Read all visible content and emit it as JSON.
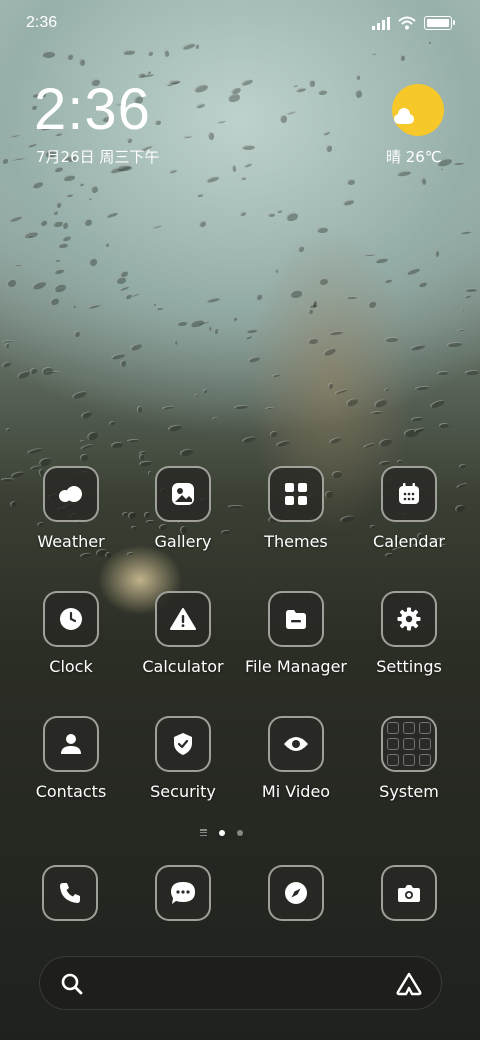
{
  "status_bar": {
    "time": "2:36"
  },
  "lockclock": {
    "time": "2:36",
    "date": "7月26日 周三下午"
  },
  "weather": {
    "text": "晴 26℃",
    "icon": "sun-cloud-icon",
    "sun_color": "#f6c82a"
  },
  "apps": [
    {
      "label": "Weather",
      "icon": "weather-icon"
    },
    {
      "label": "Gallery",
      "icon": "gallery-icon"
    },
    {
      "label": "Themes",
      "icon": "themes-icon"
    },
    {
      "label": "Calendar",
      "icon": "calendar-icon"
    },
    {
      "label": "Clock",
      "icon": "clock-icon"
    },
    {
      "label": "Calculator",
      "icon": "calculator-icon"
    },
    {
      "label": "File Manager",
      "icon": "file-manager-icon"
    },
    {
      "label": "Settings",
      "icon": "settings-icon"
    },
    {
      "label": "Contacts",
      "icon": "contacts-icon"
    },
    {
      "label": "Security",
      "icon": "security-icon"
    },
    {
      "label": "Mi Video",
      "icon": "mi-video-icon"
    },
    {
      "label": "System",
      "icon": "system-folder-icon"
    }
  ],
  "dock": [
    {
      "icon": "phone-icon"
    },
    {
      "icon": "messages-icon"
    },
    {
      "icon": "browser-icon"
    },
    {
      "icon": "camera-icon"
    }
  ],
  "pager": {
    "current_page": 1,
    "pages": 2
  },
  "search": {
    "icon": "search-icon",
    "assistant_icon": "assistant-icon"
  }
}
